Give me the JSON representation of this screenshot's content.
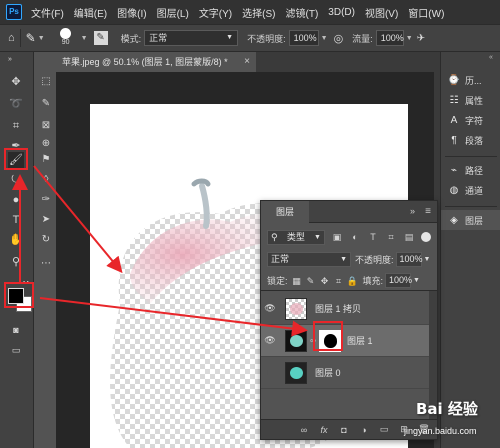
{
  "menu": {
    "logo": "Ps",
    "items": [
      "文件(F)",
      "编辑(E)",
      "图像(I)",
      "图层(L)",
      "文字(Y)",
      "选择(S)",
      "滤镜(T)",
      "3D(D)",
      "视图(V)",
      "窗口(W)"
    ]
  },
  "options": {
    "brush_size": "90",
    "mode_label": "模式:",
    "mode_value": "正常",
    "opacity_label": "不透明度:",
    "opacity_value": "100%",
    "flow_label": "流量:",
    "flow_value": "100%"
  },
  "tab": {
    "title": "苹果.jpeg @ 50.1% (图层 1, 图层蒙版/8) *",
    "close": "×"
  },
  "dock": {
    "items": [
      {
        "icon": "history-icon",
        "label": "历..."
      },
      {
        "icon": "properties-icon",
        "label": "属性"
      },
      {
        "icon": "character-icon",
        "label": "字符"
      },
      {
        "icon": "paragraph-icon",
        "label": "段落"
      },
      {
        "icon": "paths-icon",
        "label": "路径"
      },
      {
        "icon": "channels-icon",
        "label": "通道"
      },
      {
        "icon": "layers-icon",
        "label": "图层"
      }
    ]
  },
  "layers": {
    "tab_label": "图层",
    "filter_label": "类型",
    "blend_mode": "正常",
    "opacity_label": "不透明度:",
    "opacity_value": "100%",
    "lock_label": "锁定:",
    "fill_label": "填充:",
    "fill_value": "100%",
    "items": [
      {
        "name": "图层 1 拷贝",
        "visible": true,
        "selected": false
      },
      {
        "name": "图层 1",
        "visible": true,
        "selected": true
      },
      {
        "name": "图层 0",
        "visible": false,
        "selected": false
      }
    ]
  },
  "watermark": {
    "text": "Bai 经验",
    "url": "jingyan.baidu.com"
  },
  "colors": {
    "highlight": "#e8262a",
    "foreground_swatch": "#000000",
    "background_swatch": "#ffffff"
  }
}
